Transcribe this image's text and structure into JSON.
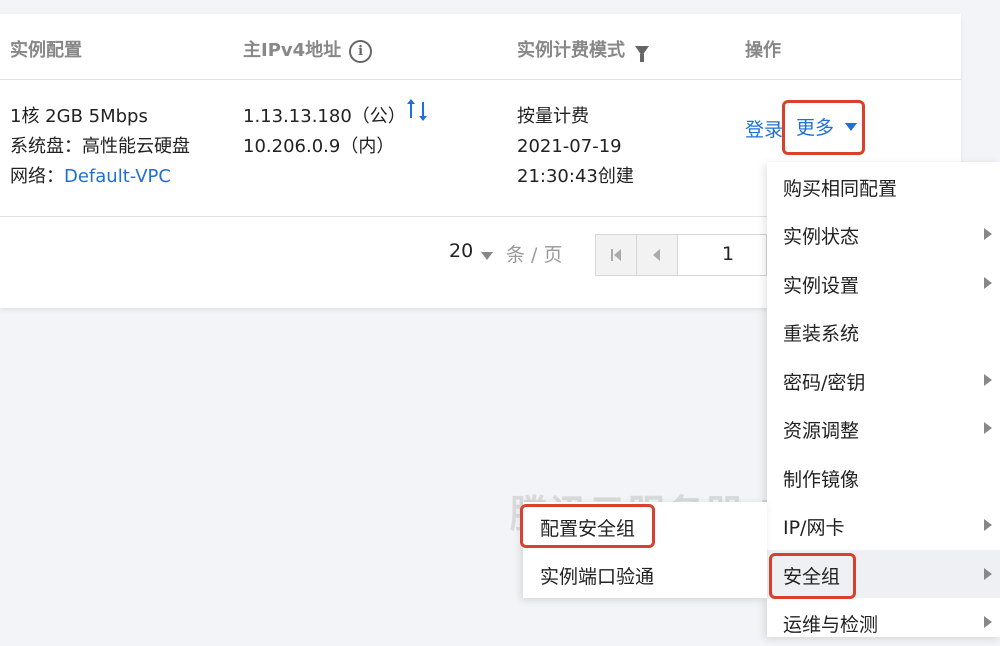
{
  "table": {
    "headers": {
      "config": "实例配置",
      "ipv4": "主IPv4地址",
      "billing": "实例计费模式",
      "actions": "操作"
    },
    "row": {
      "config_line1": "1核 2GB 5Mbps",
      "config_line2": "系统盘：高性能云硬盘",
      "network_label": "网络：",
      "network_link": "Default-VPC",
      "ip_public": "1.13.13.180（公）",
      "ip_private": "10.206.0.9（内）",
      "billing_mode": "按量计费",
      "created_date": "2021-07-19",
      "created_time": "21:30:43创建",
      "login_link": "登录",
      "more_link": "更多"
    }
  },
  "pager": {
    "page_size": "20",
    "unit": "条 / 页",
    "current_page": "1"
  },
  "menu": {
    "items": [
      {
        "label": "购买相同配置",
        "has_submenu": false
      },
      {
        "label": "实例状态",
        "has_submenu": true
      },
      {
        "label": "实例设置",
        "has_submenu": true
      },
      {
        "label": "重装系统",
        "has_submenu": false
      },
      {
        "label": "密码/密钥",
        "has_submenu": true
      },
      {
        "label": "资源调整",
        "has_submenu": true
      },
      {
        "label": "制作镜像",
        "has_submenu": false
      },
      {
        "label": "IP/网卡",
        "has_submenu": true
      },
      {
        "label": "安全组",
        "has_submenu": true
      },
      {
        "label": "运维与检测",
        "has_submenu": true
      }
    ]
  },
  "submenu": {
    "items": [
      "配置安全组",
      "实例端口验通"
    ]
  },
  "watermark": "腾讯云服务器 txyfwq.com",
  "colors": {
    "link": "#1f6fd6",
    "highlight": "#d9412e"
  }
}
